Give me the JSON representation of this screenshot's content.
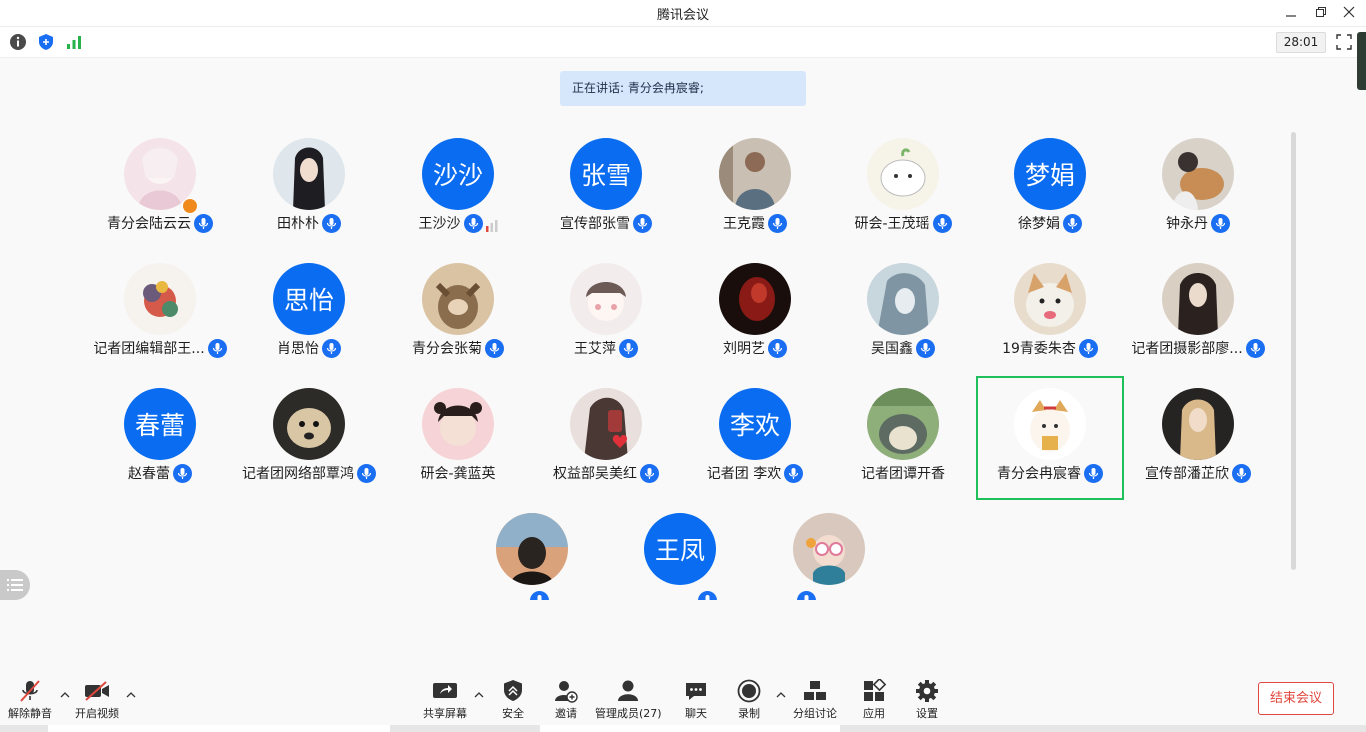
{
  "window": {
    "title": "腾讯会议"
  },
  "timer": "28:01",
  "speaking": "正在讲话: 青分会冉宸睿;",
  "participants": [
    {
      "name": "青分会陆云云",
      "avatar": "photo",
      "style": "p1",
      "owner": true
    },
    {
      "name": "田朴朴",
      "avatar": "photo",
      "style": "p2"
    },
    {
      "name": "王沙沙",
      "avatar": "text",
      "text": "沙沙",
      "signal": true
    },
    {
      "name": "宣传部张雪",
      "avatar": "text",
      "text": "张雪"
    },
    {
      "name": "王克霞",
      "avatar": "photo",
      "style": "p3"
    },
    {
      "name": "研会-王茂瑶",
      "avatar": "photo",
      "style": "p4"
    },
    {
      "name": "徐梦娟",
      "avatar": "text",
      "text": "梦娟"
    },
    {
      "name": "钟永丹",
      "avatar": "photo",
      "style": "p5"
    },
    {
      "name": "记者团编辑部王...",
      "avatar": "photo",
      "style": "p6"
    },
    {
      "name": "肖思怡",
      "avatar": "text",
      "text": "思怡"
    },
    {
      "name": "青分会张菊",
      "avatar": "photo",
      "style": "p7"
    },
    {
      "name": "王艾萍",
      "avatar": "photo",
      "style": "p8"
    },
    {
      "name": "刘明艺",
      "avatar": "photo",
      "style": "p9"
    },
    {
      "name": "吴国鑫",
      "avatar": "photo",
      "style": "p10"
    },
    {
      "name": "19青委朱杏",
      "avatar": "photo",
      "style": "p11"
    },
    {
      "name": "记者团摄影部廖...",
      "avatar": "photo",
      "style": "p12"
    },
    {
      "name": "赵春蕾",
      "avatar": "text",
      "text": "春蕾"
    },
    {
      "name": "记者团网络部覃鸿",
      "avatar": "photo",
      "style": "p13"
    },
    {
      "name": "研会-龚蓝英",
      "avatar": "photo",
      "style": "p14",
      "nomic": true
    },
    {
      "name": "权益部吴美红",
      "avatar": "photo",
      "style": "p15"
    },
    {
      "name": "记者团 李欢",
      "avatar": "text",
      "text": "李欢"
    },
    {
      "name": "记者团谭开香",
      "avatar": "photo",
      "style": "p16",
      "nomic": true
    },
    {
      "name": "青分会冉宸睿",
      "avatar": "photo",
      "style": "p17",
      "active": true
    },
    {
      "name": "宣传部潘芷欣",
      "avatar": "photo",
      "style": "p18"
    },
    {
      "name": "",
      "avatar": "photo",
      "style": "p19",
      "cut": true
    },
    {
      "name": "",
      "avatar": "text",
      "text": "王凤",
      "cut": true
    },
    {
      "name": "",
      "avatar": "photo",
      "style": "p20",
      "cut": true
    }
  ],
  "toolbar": {
    "mute": "解除静音",
    "video": "开启视频",
    "share": "共享屏幕",
    "security": "安全",
    "invite": "邀请",
    "members": "管理成员(27)",
    "chat": "聊天",
    "record": "录制",
    "breakout": "分组讨论",
    "apps": "应用",
    "settings": "设置",
    "end": "结束会议"
  },
  "colors": {
    "accent": "#0a6cf0",
    "active_border": "#1fbf5b",
    "end": "#e0473d"
  }
}
